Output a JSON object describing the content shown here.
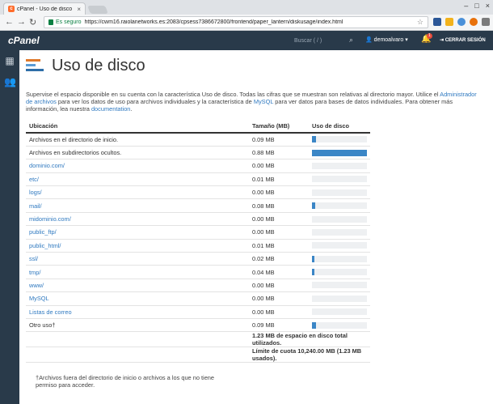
{
  "browser": {
    "tab_title": "cPanel - Uso de disco",
    "secure_label": "Es seguro",
    "url": "https://cwm16.raiolanetworks.es:2083/cpsess7386672800/frontend/paper_lantern/diskusage/index.html"
  },
  "header": {
    "logo": "cPanel",
    "search_placeholder": "Buscar ( / )",
    "user": "demoalvaro",
    "notifications": "1",
    "logout_label": "CERRAR SESIÓN"
  },
  "page": {
    "title": "Uso de disco",
    "desc_1": "Supervise el espacio disponible en su cuenta con la característica Uso de disco. Todas las cifras que se muestran son relativas al directorio mayor. Utilice el ",
    "desc_link_1": "Administrador de archivos",
    "desc_2": " para ver los datos de uso para archivos individuales y la característica de ",
    "desc_link_2": "MySQL",
    "desc_3": " para ver datos para bases de datos individuales. Para obtener más información, lea nuestra ",
    "desc_link_3": "documentation",
    "desc_4": "."
  },
  "table": {
    "headers": [
      "Ubicación",
      "Tamaño (MB)",
      "Uso de disco"
    ],
    "rows": [
      {
        "location": "Archivos en el directorio de inicio.",
        "link": false,
        "size": "0.09 MB",
        "usage": 0.07
      },
      {
        "location": "Archivos en subdirectorios ocultos.",
        "link": false,
        "size": "0.88 MB",
        "usage": 1.0
      },
      {
        "location": "dominio.com/",
        "link": true,
        "size": "0.00 MB",
        "usage": 0
      },
      {
        "location": "etc/",
        "link": true,
        "size": "0.01 MB",
        "usage": 0
      },
      {
        "location": "logs/",
        "link": true,
        "size": "0.00 MB",
        "usage": 0
      },
      {
        "location": "mail/",
        "link": true,
        "size": "0.08 MB",
        "usage": 0.065
      },
      {
        "location": "midominio.com/",
        "link": true,
        "size": "0.00 MB",
        "usage": 0
      },
      {
        "location": "public_ftp/",
        "link": true,
        "size": "0.00 MB",
        "usage": 0
      },
      {
        "location": "public_html/",
        "link": true,
        "size": "0.01 MB",
        "usage": 0
      },
      {
        "location": "ssl/",
        "link": true,
        "size": "0.02 MB",
        "usage": 0.02
      },
      {
        "location": "tmp/",
        "link": true,
        "size": "0.04 MB",
        "usage": 0.03
      },
      {
        "location": "www/",
        "link": true,
        "size": "0.00 MB",
        "usage": 0
      },
      {
        "location": "MySQL",
        "link": true,
        "size": "0.00 MB",
        "usage": 0
      },
      {
        "location": "Listas de correo",
        "link": true,
        "size": "0.00 MB",
        "usage": 0
      },
      {
        "location": "Otro uso†",
        "link": false,
        "size": "0.09 MB",
        "usage": 0.07
      }
    ],
    "total_used": "1.23 MB de espacio en disco total utilizados.",
    "quota": "Límite de cuota 10,240.00 MB (1.23 MB usados)."
  },
  "footnote": "†Archivos fuera del directorio de inicio o archivos a los que no tiene permiso para acceder."
}
